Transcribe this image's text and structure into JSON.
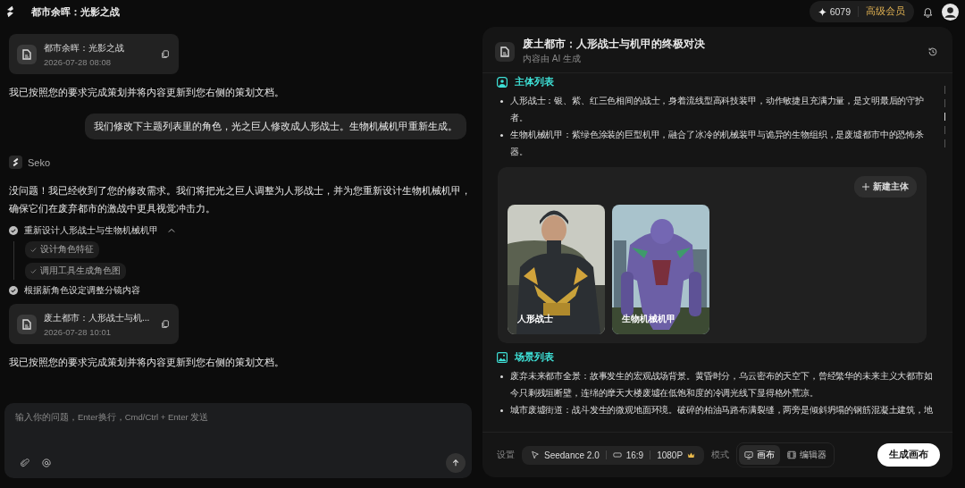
{
  "app": {
    "title": "都市余晖：光影之战"
  },
  "account": {
    "credits": "6079",
    "plan": "高级会员"
  },
  "chat": {
    "messages": [
      {
        "kind": "doc_card",
        "title": "都市余晖：光影之战",
        "date": "2026-07-28 08:08"
      },
      {
        "kind": "assistant_text",
        "text": "我已按照您的要求完成策划并将内容更新到您右侧的策划文档。"
      },
      {
        "kind": "user",
        "text": "我们修改下主题列表里的角色，光之巨人修改成人形战士。生物机械机甲重新生成。"
      },
      {
        "kind": "sender",
        "name": "Seko"
      },
      {
        "kind": "assistant_text",
        "text": "没问题！我已经收到了您的修改需求。我们将把光之巨人调整为人形战士，并为您重新设计生物机械机甲，确保它们在废弃都市的激战中更具视觉冲击力。"
      },
      {
        "kind": "steps",
        "steps": [
          {
            "label": "重新设计人形战士与生物机械机甲",
            "expanded": true,
            "children": [
              {
                "label": "设计角色特征"
              },
              {
                "label": "调用工具生成角色图"
              }
            ]
          },
          {
            "label": "根据新角色设定调整分镜内容"
          }
        ]
      },
      {
        "kind": "doc_card",
        "title": "废土都市：人形战士与机...",
        "date": "2026-07-28 10:01"
      },
      {
        "kind": "assistant_text",
        "text": "我已按照您的要求完成策划并将内容更新到您右侧的策划文档。"
      }
    ]
  },
  "composer": {
    "placeholder": "输入你的问题，Enter换行，Cmd/Ctrl + Enter 发送"
  },
  "document": {
    "title": "废土都市：人形战士与机甲的终极对决",
    "subtitle": "内容由 AI 生成",
    "sections": [
      {
        "kind": "subjects",
        "heading": "主体列表",
        "bullets": [
          "人形战士：银、紫、红三色相间的战士，身着流线型高科技装甲，动作敏捷且充满力量，是文明最后的守护者。",
          "生物机械机甲：紫绿色涂装的巨型机甲，融合了冰冷的机械装甲与诡异的生物组织，是废墟都市中的恐怖杀器。"
        ],
        "new_button": "新建主体",
        "cards": [
          {
            "label": "人形战士",
            "kind": "picture"
          },
          {
            "label": "生物机械机甲",
            "kind": "picture"
          }
        ]
      },
      {
        "kind": "scenes",
        "heading": "场景列表",
        "bullets": [
          "废弃未来都市全景：故事发生的宏观战场背景。黄昏时分，乌云密布的天空下，曾经繁华的未来主义大都市如今只剩残垣断壁，连绵的摩天大楼废墟在低饱和度的冷调光线下显得格外荒凉。",
          "城市废墟街道：战斗发生的微观地面环境。破碎的柏油马路布满裂缝，两旁是倾斜坍塌的钢筋混凝土建筑，地"
        ]
      }
    ]
  },
  "settings": {
    "label": "设置",
    "model": "Seedance 2.0",
    "ratio": "16:9",
    "resolution": "1080P",
    "mode_label": "模式",
    "modes": [
      {
        "label": "画布",
        "kind": "canvas",
        "selected": true
      },
      {
        "label": "编辑器",
        "kind": "editor",
        "selected": false
      }
    ],
    "generate": "生成画布"
  }
}
